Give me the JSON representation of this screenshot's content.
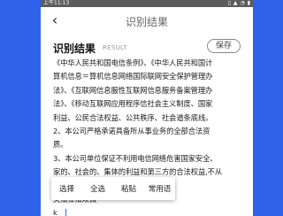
{
  "status_bar": {
    "time": "上午11:13",
    "icons": [
      "sim-icon",
      "signal-icon",
      "wifi-icon",
      "battery-icon"
    ]
  },
  "nav": {
    "title": "识别结果",
    "back_icon": "chevron-left-icon"
  },
  "result": {
    "title": "识别结果",
    "subtitle": "RESULT",
    "save_label": "保存"
  },
  "content_lines": [
    "《中华人民共和国电信条例》、《中华人民共和国计",
    "算机信息＝算机信息网络国际联网安全保护管理办",
    "法》、《互联网信息服性互联网信息服务备案管理办",
    "法》、《移动互联网应用程序信社会主义制度、国家",
    "利益、公民合法权益、公共秩序、社会道条底线。",
    "2、本公司严格承诺具备所从事业务的全部合法资",
    "质。",
    "3、本公司单位保证不利用电信网络危害国家安全、",
    "家的、社会的、集体的利益和第三方的合法权益,不从",
    "事违法……",
    "                                      关法律法规微",
    "k"
  ],
  "context_menu": {
    "items": [
      "选择",
      "全选",
      "粘贴",
      "常用语"
    ]
  },
  "colors": {
    "background": "#2f61ea",
    "status_bar": "#5c5c5c",
    "page": "#ffffff"
  }
}
